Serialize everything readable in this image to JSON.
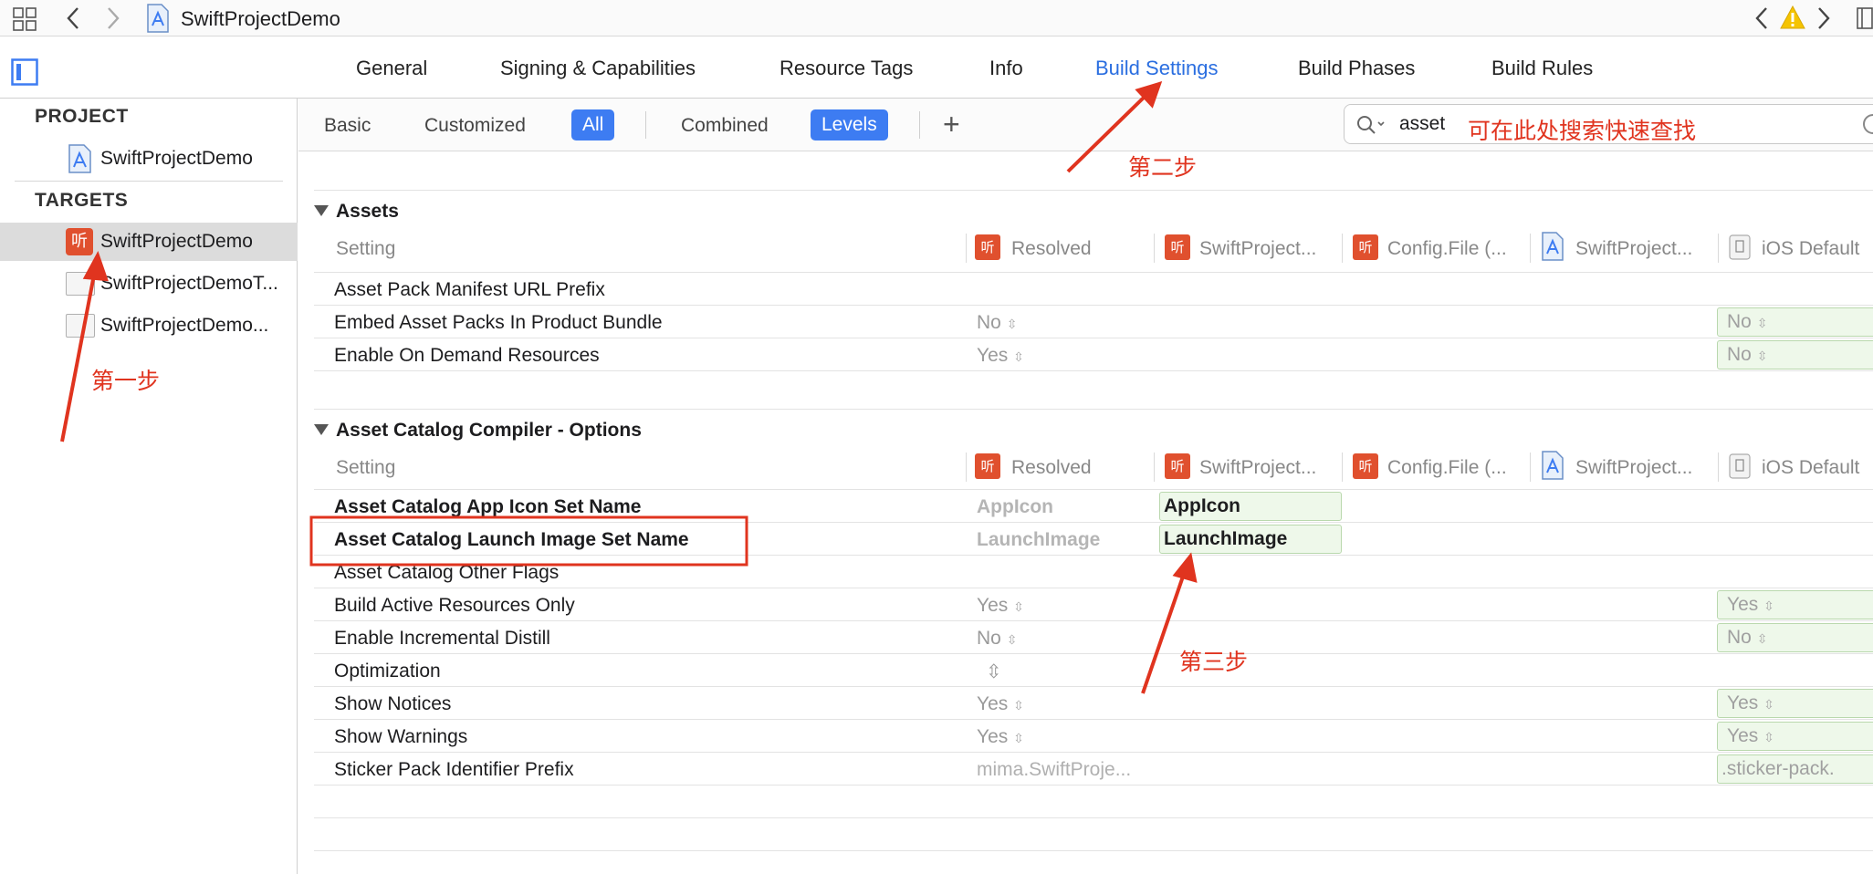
{
  "toolbar": {
    "project_name": "SwiftProjectDemo"
  },
  "tabs": [
    {
      "label": "General"
    },
    {
      "label": "Signing & Capabilities"
    },
    {
      "label": "Resource Tags"
    },
    {
      "label": "Info"
    },
    {
      "label": "Build Settings"
    },
    {
      "label": "Build Phases"
    },
    {
      "label": "Build Rules"
    }
  ],
  "sidebar": {
    "project_header": "PROJECT",
    "project_item": "SwiftProjectDemo",
    "targets_header": "TARGETS",
    "targets": [
      {
        "label": "SwiftProjectDemo"
      },
      {
        "label": "SwiftProjectDemoT..."
      },
      {
        "label": "SwiftProjectDemo..."
      }
    ]
  },
  "filters": {
    "basic": "Basic",
    "customized": "Customized",
    "all": "All",
    "combined": "Combined",
    "levels": "Levels",
    "add": "+"
  },
  "search": {
    "value": "asset"
  },
  "columns": {
    "setting": "Setting",
    "resolved": "Resolved",
    "target": "SwiftProject...",
    "config": "Config.File (...",
    "project": "SwiftProject...",
    "ios_default": "iOS Default",
    "app_glyph": "听"
  },
  "sections": [
    {
      "title": "Assets",
      "rows": [
        {
          "name": "Asset Pack Manifest URL Prefix",
          "resolved": "",
          "target": "",
          "ios": ""
        },
        {
          "name": "Embed Asset Packs In Product Bundle",
          "resolved": "No",
          "target": "",
          "ios": "No"
        },
        {
          "name": "Enable On Demand Resources",
          "resolved": "Yes",
          "target": "",
          "ios": "No"
        }
      ]
    },
    {
      "title": "Asset Catalog Compiler - Options",
      "rows": [
        {
          "name": "Asset Catalog App Icon Set Name",
          "resolved": "AppIcon",
          "target": "AppIcon",
          "ios": ""
        },
        {
          "name": "Asset Catalog Launch Image Set Name",
          "resolved": "LaunchImage",
          "target": "LaunchImage",
          "ios": ""
        },
        {
          "name": "Asset Catalog Other Flags",
          "resolved": "",
          "target": "",
          "ios": ""
        },
        {
          "name": "Build Active Resources Only",
          "resolved": "Yes",
          "target": "",
          "ios": "Yes"
        },
        {
          "name": "Enable Incremental Distill",
          "resolved": "No",
          "target": "",
          "ios": "No"
        },
        {
          "name": "Optimization",
          "resolved": "",
          "target": "",
          "ios": ""
        },
        {
          "name": "Show Notices",
          "resolved": "Yes",
          "target": "",
          "ios": "Yes"
        },
        {
          "name": "Show Warnings",
          "resolved": "Yes",
          "target": "",
          "ios": "Yes"
        },
        {
          "name": "Sticker Pack Identifier Prefix",
          "resolved": "mima.SwiftProje...",
          "target": "",
          "ios": ".sticker-pack."
        }
      ]
    }
  ],
  "annotations": {
    "step1": "第一步",
    "step2": "第二步",
    "step3": "第三步",
    "search_hint": "可在此处搜索快速查找"
  },
  "colors": {
    "accent": "#3d7cf2",
    "annotation": "#e0341f",
    "app_icon": "#e0502e",
    "warning": "#f5c400"
  },
  "stepper_glyph": "⇳"
}
